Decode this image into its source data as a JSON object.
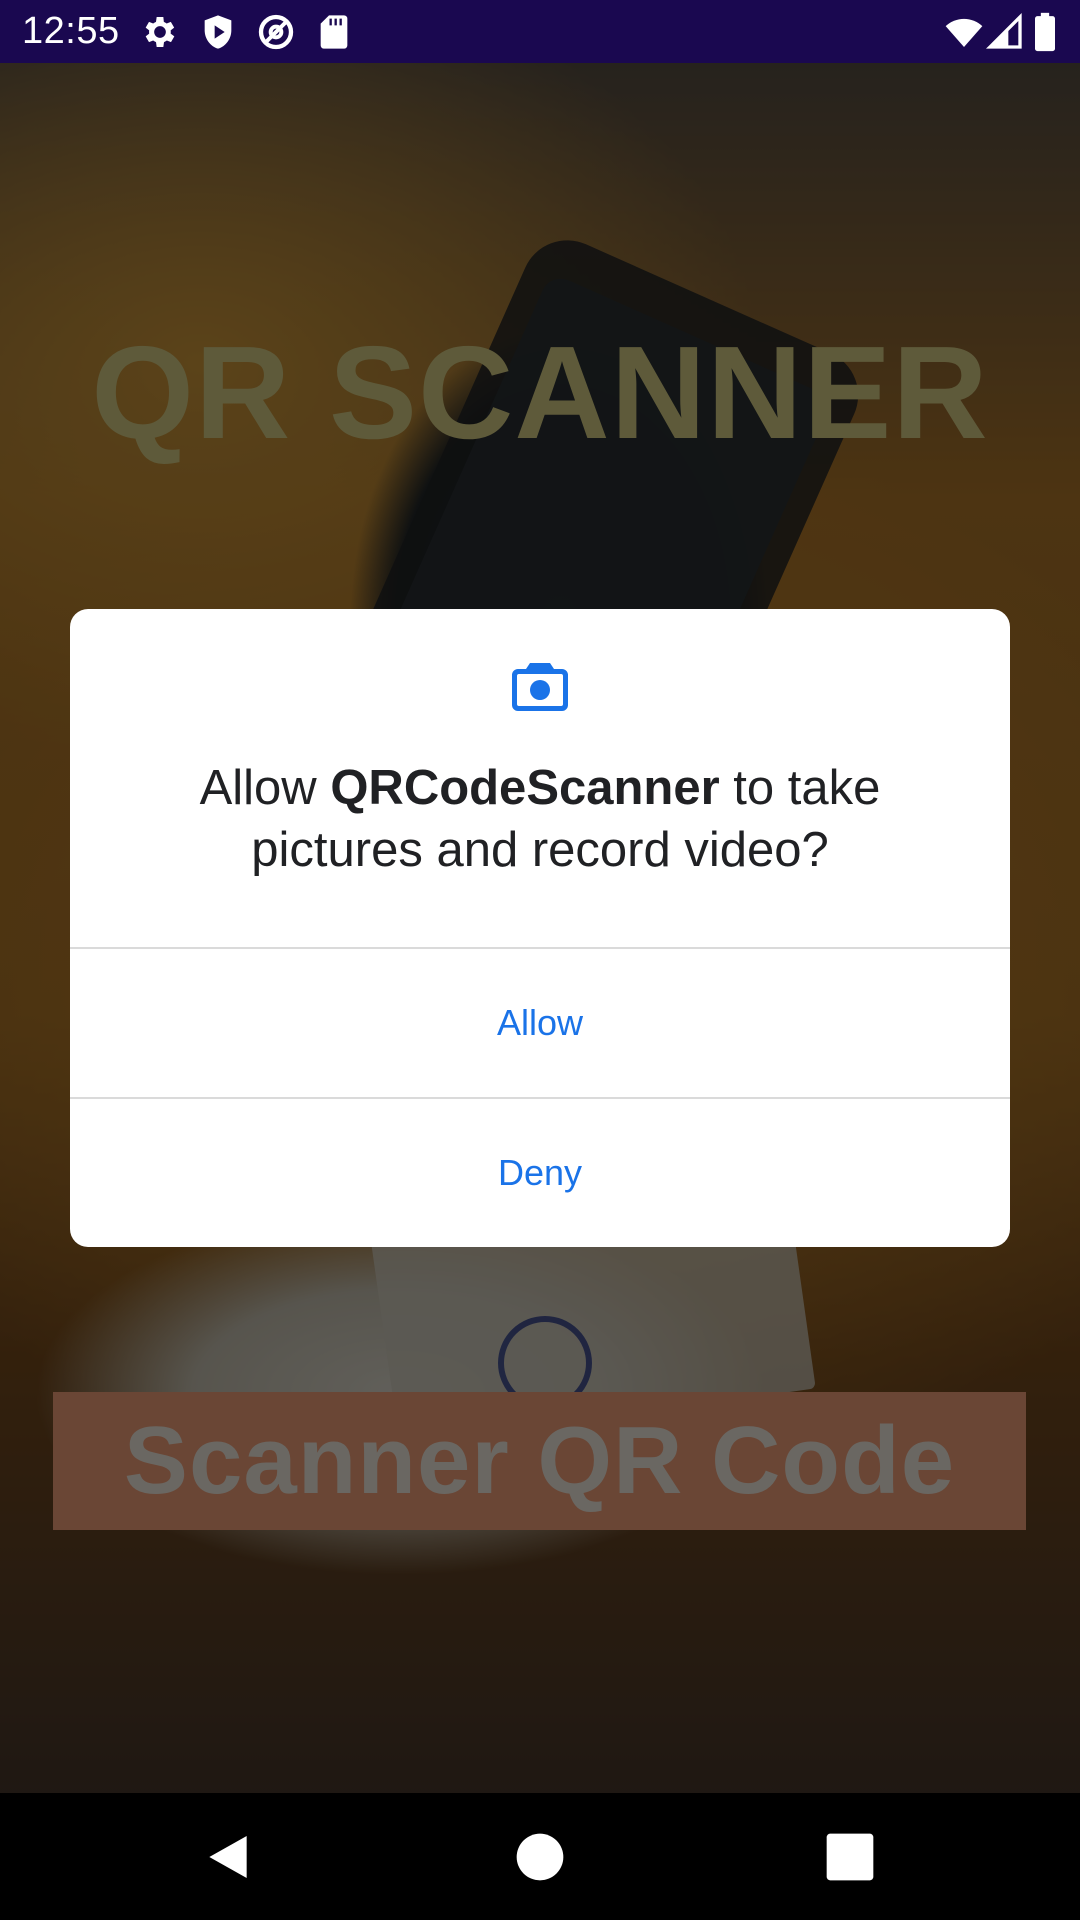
{
  "status_bar": {
    "time": "12:55",
    "icons_left": [
      "gear-icon",
      "shield-play-icon",
      "at-sign-icon",
      "sd-card-icon"
    ],
    "icons_right": [
      "wifi-icon",
      "cell-signal-icon",
      "battery-icon"
    ]
  },
  "app": {
    "title": "QR SCANNER",
    "scan_button_label": "Scanner QR Code"
  },
  "dialog": {
    "icon": "camera-icon",
    "message_prefix": "Allow ",
    "app_name": "QRCodeScanner",
    "message_suffix": " to take pictures and record video?",
    "allow_label": "Allow",
    "deny_label": "Deny",
    "accent_color": "#1a73e8"
  },
  "nav_bar": {
    "buttons": [
      "back-icon",
      "home-icon",
      "recents-icon"
    ]
  }
}
